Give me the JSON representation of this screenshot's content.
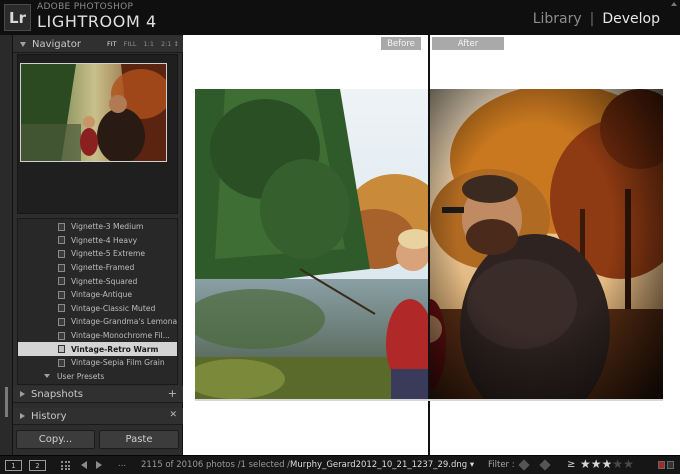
{
  "app": {
    "logo": "Lr",
    "brand_small": "ADOBE PHOTOSHOP",
    "brand_big": "LIGHTROOM 4"
  },
  "modules": {
    "library": "Library",
    "develop": "Develop",
    "active": "Develop"
  },
  "navigator": {
    "title": "Navigator",
    "zoom": [
      "FIT",
      "FILL",
      "1:1",
      "2:1 ↕"
    ]
  },
  "presets": {
    "items": [
      "Vignette-3 Medium",
      "Vignette-4 Heavy",
      "Vignette-5 Extreme",
      "Vignette-Framed",
      "Vignette-Squared",
      "Vintage-Antique",
      "Vintage-Classic Muted",
      "Vintage-Grandma's Lemonade",
      "Vintage-Monochrome Fil...",
      "Vintage-Retro Warm",
      "Vintage-Sepia Film Grain"
    ],
    "selected": "Vintage-Retro Warm",
    "folder": "User Presets"
  },
  "snapshots": {
    "title": "Snapshots"
  },
  "history": {
    "title": "History"
  },
  "buttons": {
    "copy": "Copy...",
    "paste": "Paste"
  },
  "compare": {
    "before": "Before",
    "after": "After"
  },
  "filmstrip": {
    "monitor1": "1",
    "monitor2": "2",
    "ellipsis": "...",
    "count_text": "2115 of 20106 photos /1 selected /",
    "filename": "Murphy_Gerard2012_10_21_1237_29.dng ▾",
    "filter_label": "Filter :",
    "rating_op": "≥",
    "stars": 3,
    "stars_max": 5
  },
  "colors": {
    "chrome": "#1e1e1e",
    "panel": "#2d2d2d",
    "selected_row": "#d4d4d4",
    "canvas": "#ffffff"
  }
}
